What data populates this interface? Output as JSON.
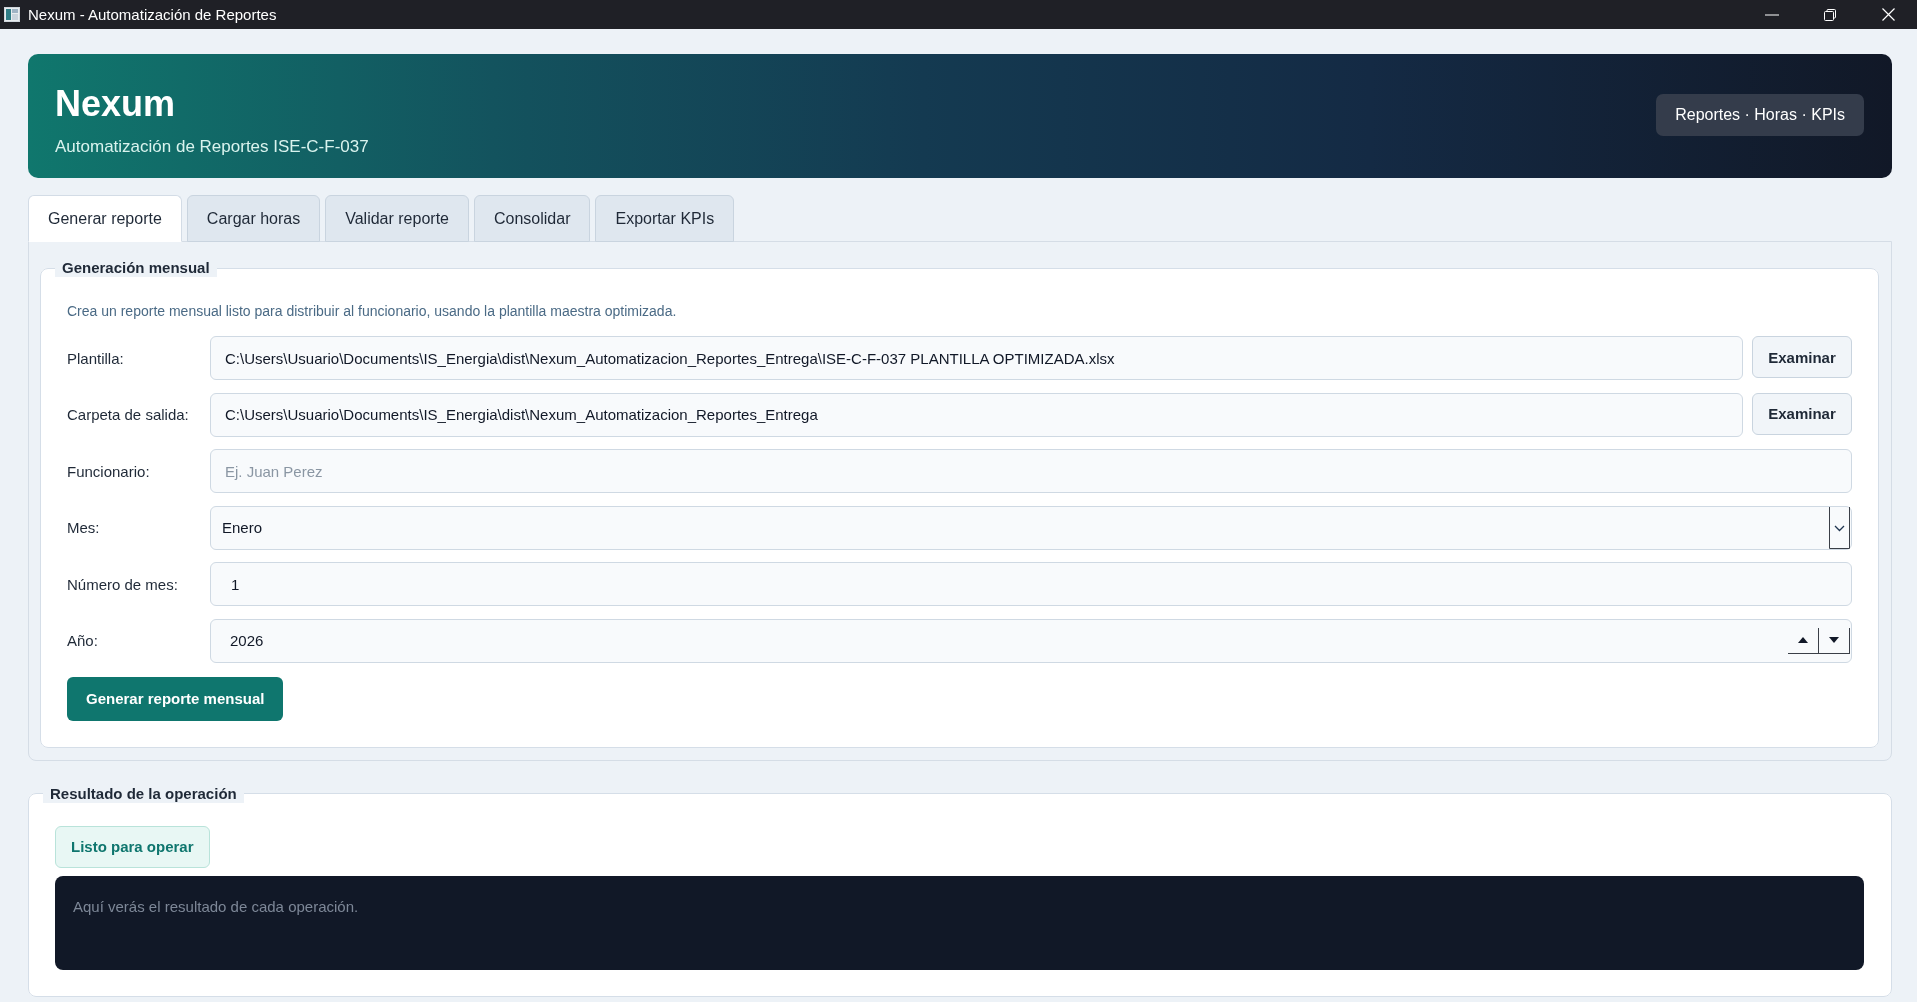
{
  "window": {
    "title": "Nexum - Automatización de Reportes"
  },
  "header": {
    "title": "Nexum",
    "subtitle": "Automatización de Reportes ISE-C-F-037",
    "badge": "Reportes · Horas · KPIs"
  },
  "tabs": [
    {
      "label": "Generar reporte",
      "selected": true
    },
    {
      "label": "Cargar horas",
      "selected": false
    },
    {
      "label": "Validar reporte",
      "selected": false
    },
    {
      "label": "Consolidar",
      "selected": false
    },
    {
      "label": "Exportar KPIs",
      "selected": false
    }
  ],
  "generation": {
    "title": "Generación mensual",
    "description": "Crea un reporte mensual listo para distribuir al funcionario, usando la plantilla maestra optimizada.",
    "fields": [
      {
        "kind": "path",
        "label": "Plantilla:",
        "value": "C:\\Users\\Usuario\\Documents\\IS_Energia\\dist\\Nexum_Automatizacion_Reportes_Entrega\\ISE-C-F-037 PLANTILLA OPTIMIZADA.xlsx",
        "button": "Examinar"
      },
      {
        "kind": "path",
        "label": "Carpeta de salida:",
        "value": "C:\\Users\\Usuario\\Documents\\IS_Energia\\dist\\Nexum_Automatizacion_Reportes_Entrega",
        "button": "Examinar"
      },
      {
        "kind": "text",
        "label": "Funcionario:",
        "placeholder": "Ej. Juan Perez"
      },
      {
        "kind": "select",
        "label": "Mes:",
        "value": "Enero"
      },
      {
        "kind": "number",
        "label": "Número de mes:",
        "value": "1"
      },
      {
        "kind": "spin",
        "label": "Año:",
        "value": "2026"
      }
    ],
    "submit": "Generar reporte mensual"
  },
  "result": {
    "title": "Resultado de la operación",
    "status": "Listo para operar",
    "output": "Aquí verás el resultado de cada operación."
  }
}
